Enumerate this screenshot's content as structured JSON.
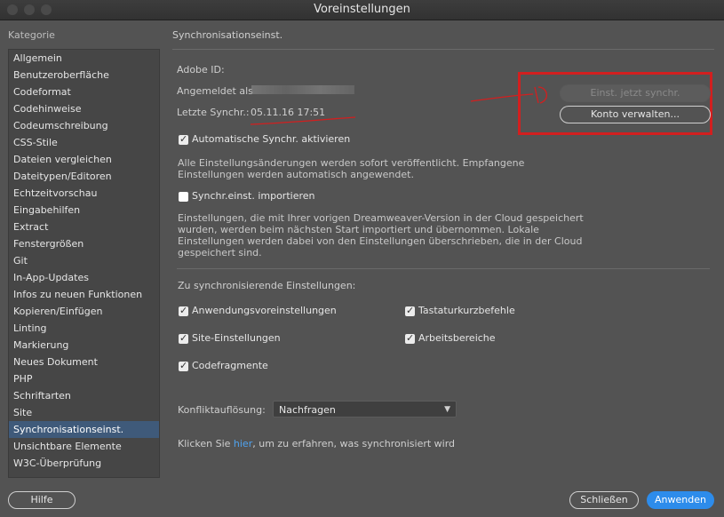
{
  "window": {
    "title": "Voreinstellungen"
  },
  "sidebar": {
    "label": "Kategorie",
    "items": [
      "Allgemein",
      "Benutzeroberfläche",
      "Codeformat",
      "Codehinweise",
      "Codeumschreibung",
      "CSS-Stile",
      "Dateien vergleichen",
      "Dateitypen/Editoren",
      "Echtzeitvorschau",
      "Eingabehilfen",
      "Extract",
      "Fenstergrößen",
      "Git",
      "In-App-Updates",
      "Infos zu neuen Funktionen",
      "Kopieren/Einfügen",
      "Linting",
      "Markierung",
      "Neues Dokument",
      "PHP",
      "Schriftarten",
      "Site",
      "Synchronisationseinst.",
      "Unsichtbare Elemente",
      "W3C-Überprüfung"
    ],
    "selected_index": 22
  },
  "main": {
    "title": "Synchronisationseinst.",
    "adobe_id_label": "Adobe ID:",
    "signed_in_label": "Angemeldet als",
    "last_sync_label": "Letzte Synchr.:",
    "last_sync_value": "05.11.16 17:51",
    "sync_now_button": "Einst. jetzt synchr.",
    "manage_account_button": "Konto verwalten...",
    "auto_sync_label": "Automatische Synchr. aktivieren",
    "auto_sync_desc": "Alle Einstellungsänderungen werden sofort veröffentlicht. Empfangene\nEinstellungen werden automatisch angewendet.",
    "import_label": "Synchr.einst. importieren",
    "import_desc": "Einstellungen, die mit Ihrer vorigen Dreamweaver-Version in der Cloud gespeichert\nwurden, werden beim nächsten Start importiert und übernommen. Lokale\nEinstellungen werden dabei von den Einstellungen überschrieben, die in der Cloud\ngespeichert sind.",
    "settings_heading": "Zu synchronisierende Einstellungen:",
    "settings": {
      "app_prefs": "Anwendungsvoreinstellungen",
      "shortcuts": "Tastaturkurzbefehle",
      "site_settings": "Site-Einstellungen",
      "workspaces": "Arbeitsbereiche",
      "snippets": "Codefragmente"
    },
    "conflict_label": "Konfliktauflösung:",
    "conflict_value": "Nachfragen",
    "info_prefix": "Klicken Sie",
    "info_link": "hier",
    "info_suffix": ", um zu erfahren, was synchronisiert wird"
  },
  "footer": {
    "help": "Hilfe",
    "close": "Schließen",
    "apply": "Anwenden"
  },
  "colors": {
    "accent": "#2d8ceb",
    "annotation_red": "#d21f1f",
    "selection": "#3f5a7a"
  }
}
